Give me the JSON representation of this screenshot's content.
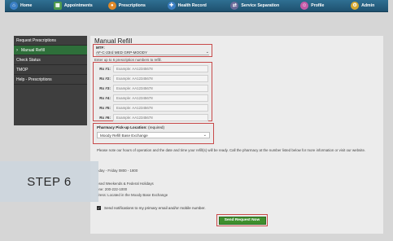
{
  "nav": {
    "items": [
      {
        "label": "Home",
        "icon": "home-icon",
        "color": "#3b7fc4"
      },
      {
        "label": "Appointments",
        "icon": "calendar-icon",
        "color": "#4e9a4e"
      },
      {
        "label": "Prescriptions",
        "icon": "pill-icon",
        "color": "#e08a2a"
      },
      {
        "label": "Health Record",
        "icon": "health-record-icon",
        "color": "#3b7fc4"
      },
      {
        "label": "Service Separation",
        "icon": "separation-icon",
        "color": "#6b6b9a"
      },
      {
        "label": "Profile",
        "icon": "profile-icon",
        "color": "#c45aa8"
      },
      {
        "label": "Admin",
        "icon": "admin-icon",
        "color": "#d6a830"
      }
    ]
  },
  "sidebar": {
    "items": [
      {
        "label": "Request Prescriptions",
        "active": false
      },
      {
        "label": "Manual Refill",
        "active": true
      },
      {
        "label": "Check Status",
        "active": false
      },
      {
        "label": "TMOP",
        "active": false
      },
      {
        "label": "Help - Prescriptions",
        "active": false
      }
    ]
  },
  "main": {
    "title": "Manual Refill",
    "mtf_label": "MTF:",
    "mtf_value": "AF-C-23rd MED GRP-MOODY",
    "rx_instructions": "Enter up to 6 prescription numbers to refill.",
    "rx_rows": [
      {
        "label": "Rx #1:",
        "placeholder": "Example: AA12345678"
      },
      {
        "label": "Rx #2:",
        "placeholder": "Example: AA12345678"
      },
      {
        "label": "Rx #3:",
        "placeholder": "Example: AA12345678"
      },
      {
        "label": "Rx #4:",
        "placeholder": "Example: AA12345678"
      },
      {
        "label": "Rx #5:",
        "placeholder": "Example: AA12345678"
      },
      {
        "label": "Rx #6:",
        "placeholder": "Example: AA12345678"
      }
    ],
    "pickup_label": "Pharmacy Pick-up Location:",
    "pickup_required": "(required)",
    "pickup_value": "Moody Refill Base Exchange",
    "notice": "Please note our hours of operation and the date and time your refill(s) will be ready. Call the pharmacy at the number listed below for more information or visit our website.",
    "hours": "nday - Friday 0800 - 1800",
    "closed_line1": "osed Weekends & Federal Holidays",
    "closed_line2": "one:   200-222-1000",
    "closed_line3": "dress:   Located in the Moody Base Exchange",
    "notify_label": "Send notifications to my primary email and/or mobile number.",
    "send_button": "Send Request Now"
  },
  "overlay": {
    "step_text": "STEP 6"
  }
}
